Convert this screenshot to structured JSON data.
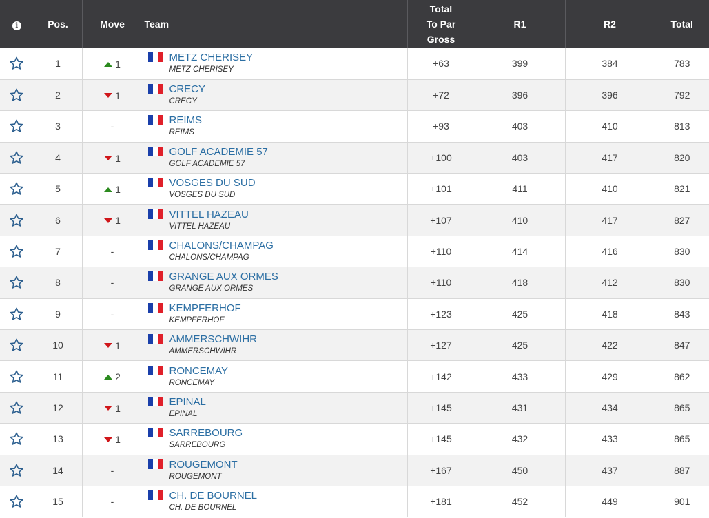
{
  "colors": {
    "header_bg": "#3b3b3e",
    "link": "#2b6ea3",
    "arrow_up": "#2b8a1e",
    "arrow_down": "#d0161a",
    "flag_blue": "#1a3faa",
    "flag_white": "#ffffff",
    "flag_red": "#e0202a"
  },
  "header": {
    "info_icon": "i",
    "pos": "Pos.",
    "move": "Move",
    "team": "Team",
    "total_line1": "Total",
    "total_line2": "To Par",
    "total_line3": "Gross",
    "r1": "R1",
    "r2": "R2",
    "total": "Total"
  },
  "rows": [
    {
      "pos": "1",
      "move_dir": "up",
      "move": "1",
      "team": "METZ CHERISEY",
      "sub": "METZ CHERISEY",
      "to_par": "+63",
      "r1": "399",
      "r2": "384",
      "total": "783"
    },
    {
      "pos": "2",
      "move_dir": "down",
      "move": "1",
      "team": "CRECY",
      "sub": "CRECY",
      "to_par": "+72",
      "r1": "396",
      "r2": "396",
      "total": "792"
    },
    {
      "pos": "3",
      "move_dir": "none",
      "move": "-",
      "team": "REIMS",
      "sub": "REIMS",
      "to_par": "+93",
      "r1": "403",
      "r2": "410",
      "total": "813"
    },
    {
      "pos": "4",
      "move_dir": "down",
      "move": "1",
      "team": "GOLF ACADEMIE 57",
      "sub": "GOLF ACADEMIE 57",
      "to_par": "+100",
      "r1": "403",
      "r2": "417",
      "total": "820"
    },
    {
      "pos": "5",
      "move_dir": "up",
      "move": "1",
      "team": "VOSGES DU SUD",
      "sub": "VOSGES DU SUD",
      "to_par": "+101",
      "r1": "411",
      "r2": "410",
      "total": "821"
    },
    {
      "pos": "6",
      "move_dir": "down",
      "move": "1",
      "team": "VITTEL HAZEAU",
      "sub": "VITTEL HAZEAU",
      "to_par": "+107",
      "r1": "410",
      "r2": "417",
      "total": "827"
    },
    {
      "pos": "7",
      "move_dir": "none",
      "move": "-",
      "team": "CHALONS/CHAMPAG",
      "sub": "CHALONS/CHAMPAG",
      "to_par": "+110",
      "r1": "414",
      "r2": "416",
      "total": "830"
    },
    {
      "pos": "8",
      "move_dir": "none",
      "move": "-",
      "team": "GRANGE AUX ORMES",
      "sub": "GRANGE AUX ORMES",
      "to_par": "+110",
      "r1": "418",
      "r2": "412",
      "total": "830"
    },
    {
      "pos": "9",
      "move_dir": "none",
      "move": "-",
      "team": "KEMPFERHOF",
      "sub": "KEMPFERHOF",
      "to_par": "+123",
      "r1": "425",
      "r2": "418",
      "total": "843"
    },
    {
      "pos": "10",
      "move_dir": "down",
      "move": "1",
      "team": "AMMERSCHWIHR",
      "sub": "AMMERSCHWIHR",
      "to_par": "+127",
      "r1": "425",
      "r2": "422",
      "total": "847"
    },
    {
      "pos": "11",
      "move_dir": "up",
      "move": "2",
      "team": "RONCEMAY",
      "sub": "RONCEMAY",
      "to_par": "+142",
      "r1": "433",
      "r2": "429",
      "total": "862"
    },
    {
      "pos": "12",
      "move_dir": "down",
      "move": "1",
      "team": "EPINAL",
      "sub": "EPINAL",
      "to_par": "+145",
      "r1": "431",
      "r2": "434",
      "total": "865"
    },
    {
      "pos": "13",
      "move_dir": "down",
      "move": "1",
      "team": "SARREBOURG",
      "sub": "SARREBOURG",
      "to_par": "+145",
      "r1": "432",
      "r2": "433",
      "total": "865"
    },
    {
      "pos": "14",
      "move_dir": "none",
      "move": "-",
      "team": "ROUGEMONT",
      "sub": "ROUGEMONT",
      "to_par": "+167",
      "r1": "450",
      "r2": "437",
      "total": "887"
    },
    {
      "pos": "15",
      "move_dir": "none",
      "move": "-",
      "team": "CH. DE BOURNEL",
      "sub": "CH. DE BOURNEL",
      "to_par": "+181",
      "r1": "452",
      "r2": "449",
      "total": "901"
    }
  ]
}
